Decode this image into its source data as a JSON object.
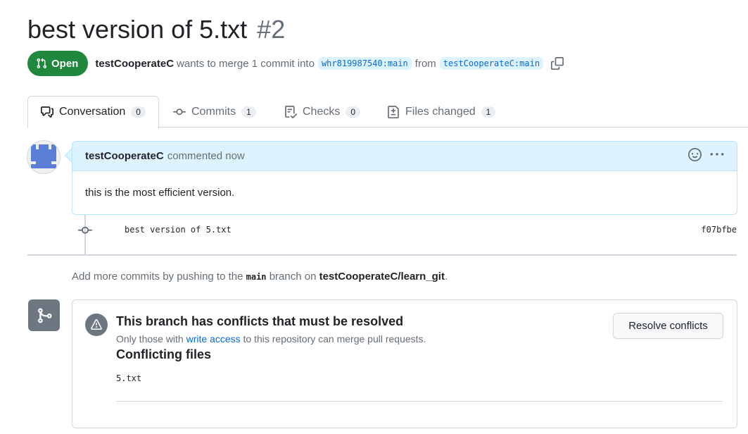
{
  "pr": {
    "title": "best version of 5.txt",
    "number": "#2",
    "state_label": "Open",
    "author": "testCooperateC",
    "merge_text_1": "wants to merge 1 commit into",
    "base_branch": "whr819987540:main",
    "merge_text_2": "from",
    "head_branch": "testCooperateC:main"
  },
  "tabs": [
    {
      "label": "Conversation",
      "count": "0",
      "icon": "comment-discussion-icon"
    },
    {
      "label": "Commits",
      "count": "1",
      "icon": "git-commit-icon"
    },
    {
      "label": "Checks",
      "count": "0",
      "icon": "checklist-icon"
    },
    {
      "label": "Files changed",
      "count": "1",
      "icon": "file-diff-icon"
    }
  ],
  "comment": {
    "author": "testCooperateC",
    "time": "commented now",
    "body": "this is the most efficient version."
  },
  "commit": {
    "message": "best version of 5.txt",
    "sha": "f07bfbe"
  },
  "hint": {
    "part1": "Add more commits by pushing to the",
    "branch": "main",
    "part2": "branch on",
    "repo": "testCooperateC/learn_git",
    "end": "."
  },
  "merge": {
    "title": "This branch has conflicts that must be resolved",
    "sub_part1": "Only those with",
    "sub_link": "write access",
    "sub_part2": "to this repository can merge pull requests.",
    "files_title": "Conflicting files",
    "files": [
      "5.txt"
    ],
    "resolve_label": "Resolve conflicts"
  },
  "colors": {
    "open_green": "#1f883d",
    "link_blue": "#0969da",
    "comment_header_bg": "#ddf4ff",
    "muted": "#656d76"
  }
}
